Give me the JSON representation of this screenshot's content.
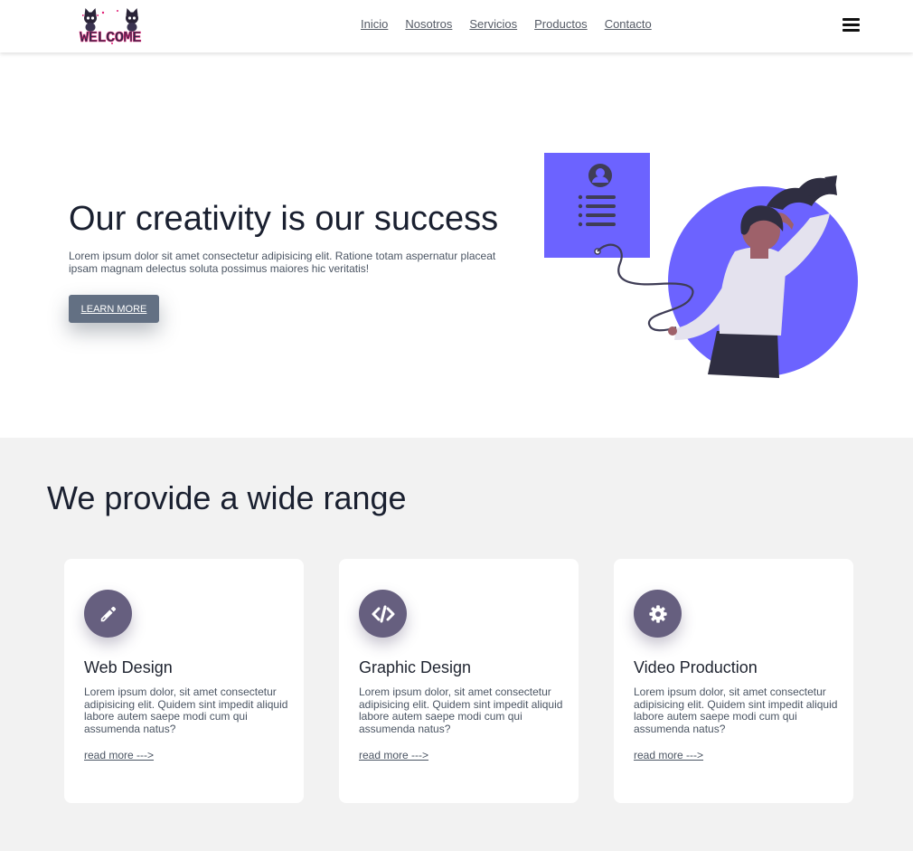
{
  "header": {
    "logo_text": "WELCOME",
    "nav": [
      "Inicio",
      "Nosotros",
      "Servicios",
      "Productos",
      "Contacto"
    ],
    "menu_icon": "hamburger-menu-icon"
  },
  "hero": {
    "title": "Our creativity is our success",
    "text": "Lorem ipsum dolor sit amet consectetur adipisicing elit. Ratione totam aspernatur placeat ipsam magnam delectus soluta possimus maiores hic veritatis!",
    "button_label": "LEARN MORE",
    "illustration": "woman-with-profile-card-illustration"
  },
  "services": {
    "title": "We provide a wide range",
    "cards": [
      {
        "icon": "pencil-icon",
        "title": "Web Design",
        "text": "Lorem ipsum dolor, sit amet consectetur adipisicing elit. Quidem sint impedit aliquid labore autem saepe modi cum qui assumenda natus?",
        "link": "read more --->"
      },
      {
        "icon": "code-icon",
        "title": "Graphic Design",
        "text": "Lorem ipsum dolor, sit amet consectetur adipisicing elit. Quidem sint impedit aliquid labore autem saepe modi cum qui assumenda natus?",
        "link": "read more --->"
      },
      {
        "icon": "gear-icon",
        "title": "Video Production",
        "text": "Lorem ipsum dolor, sit amet consectetur adipisicing elit. Quidem sint impedit aliquid labore autem saepe modi cum qui assumenda natus?",
        "link": "read more --->"
      }
    ]
  },
  "colors": {
    "accent_purple": "#6c63ff",
    "icon_circle": "#665f7f",
    "button": "#637083",
    "section_bg": "#f2f2f2",
    "heading": "#1a2030"
  }
}
